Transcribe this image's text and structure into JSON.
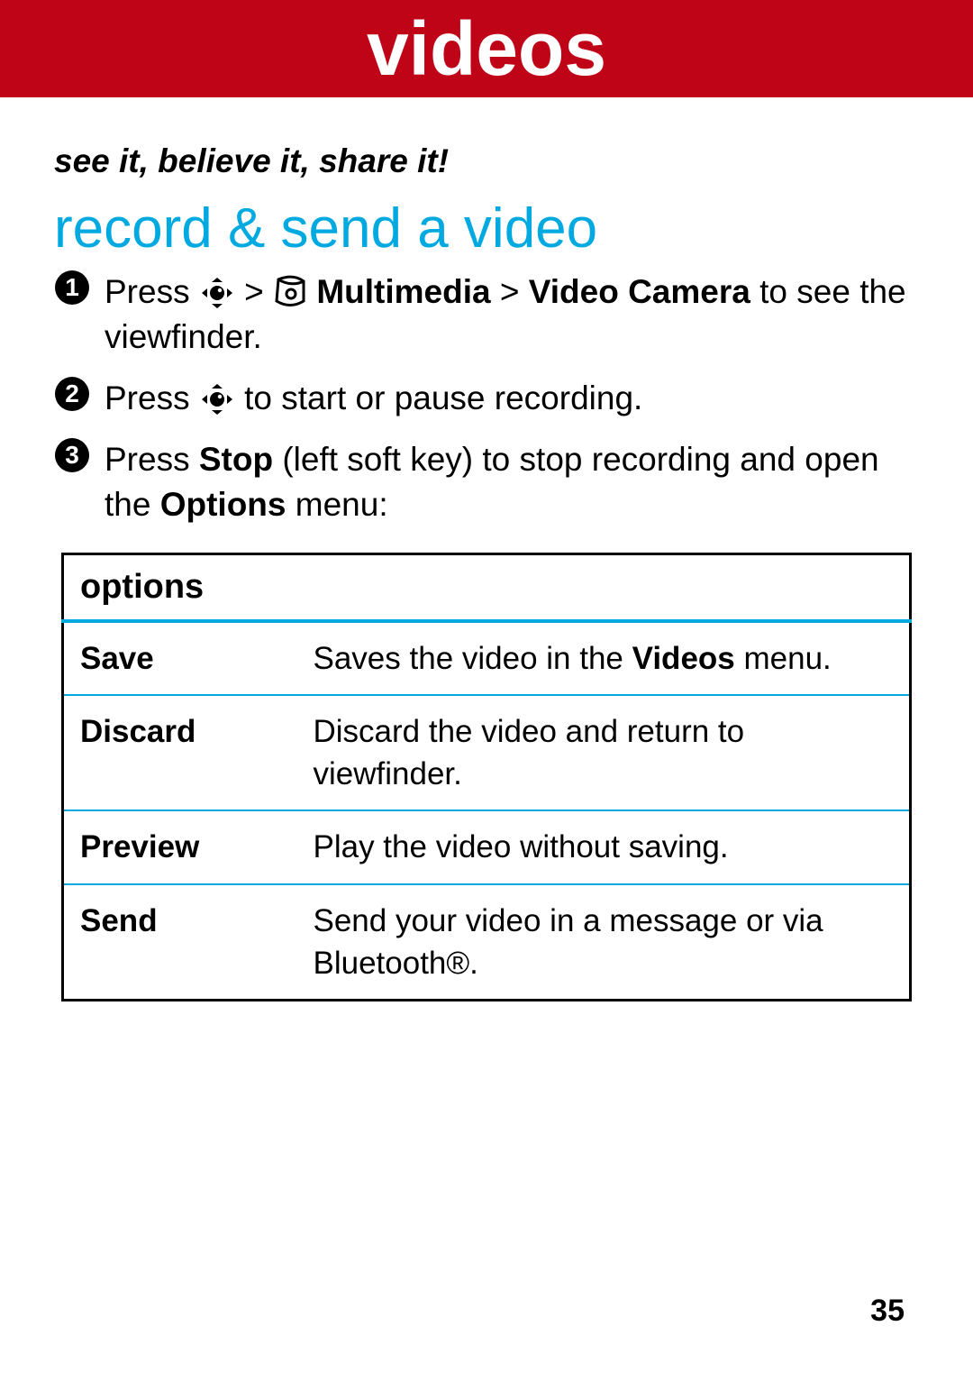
{
  "banner": {
    "title": "videos"
  },
  "tagline": "see it, believe it, share it!",
  "heading": "record & send a video",
  "steps": {
    "s1": {
      "press": "Press ",
      "gt1": " > ",
      "multimedia": "Multimedia",
      "gt2": " > ",
      "videocam": "Video Camera",
      "rest": " to see the viewfinder."
    },
    "s2": {
      "press": "Press ",
      "rest": " to start or pause recording."
    },
    "s3": {
      "press": "Press ",
      "stop": "Stop",
      "mid": " (left soft key) to stop recording and open the ",
      "options": "Options",
      "rest": " menu:"
    }
  },
  "options_header": "options",
  "options": [
    {
      "name": "Save",
      "desc_pre": "Saves the video in the ",
      "desc_bold": "Videos",
      "desc_post": " menu."
    },
    {
      "name": "Discard",
      "desc_pre": "Discard the video and return to viewfinder.",
      "desc_bold": "",
      "desc_post": ""
    },
    {
      "name": "Preview",
      "desc_pre": "Play the video without saving.",
      "desc_bold": "",
      "desc_post": ""
    },
    {
      "name": "Send",
      "desc_pre": "Send your video in a message or via Bluetooth®.",
      "desc_bold": "",
      "desc_post": ""
    }
  ],
  "page_number": "35"
}
